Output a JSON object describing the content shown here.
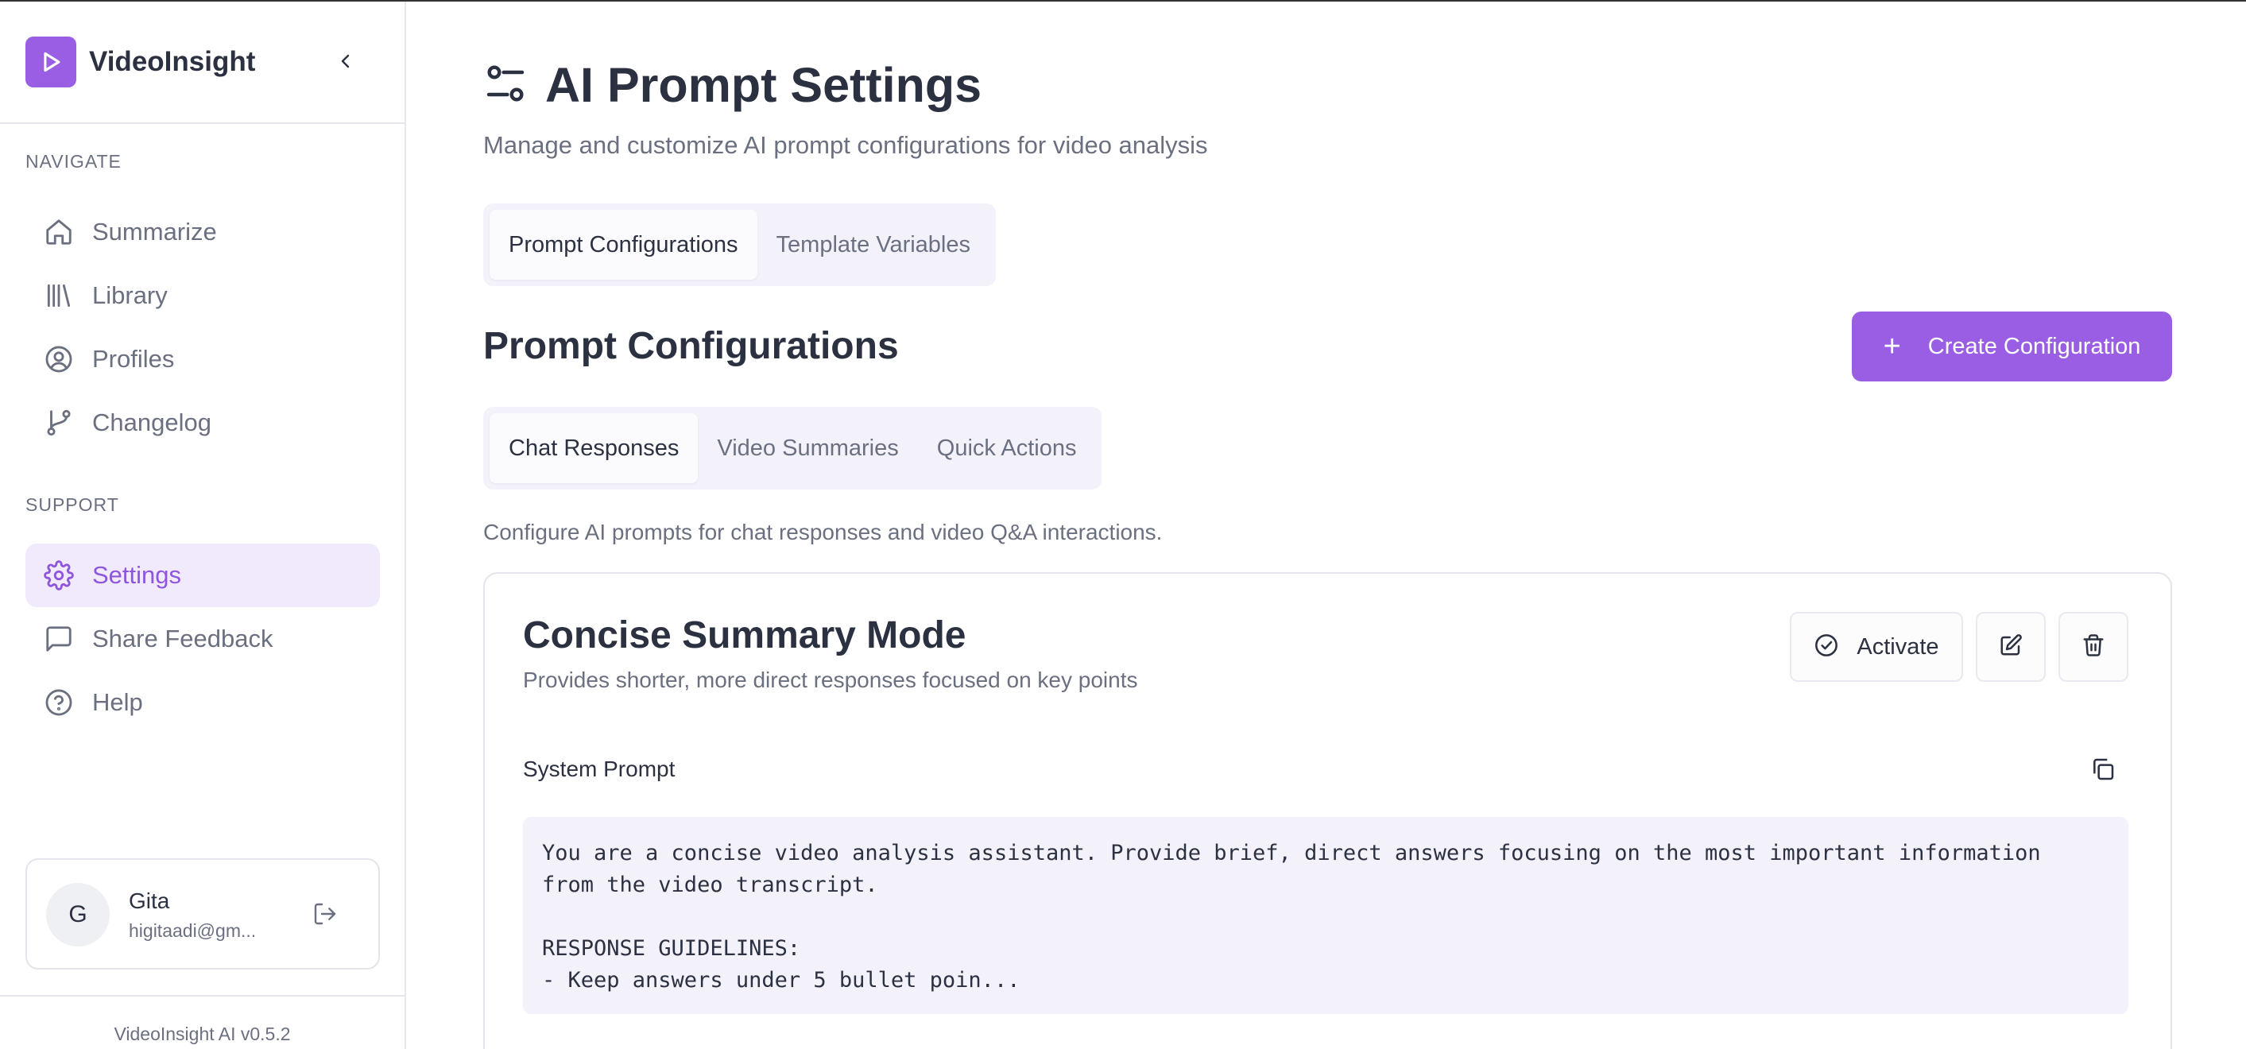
{
  "app": {
    "name": "VideoInsight",
    "version": "VideoInsight AI v0.5.2",
    "accent_color": "#9a5ee4"
  },
  "sidebar": {
    "navigate_label": "NAVIGATE",
    "support_label": "SUPPORT",
    "navigate_items": [
      {
        "label": "Summarize",
        "icon": "home-icon"
      },
      {
        "label": "Library",
        "icon": "library-icon"
      },
      {
        "label": "Profiles",
        "icon": "user-circle-icon"
      },
      {
        "label": "Changelog",
        "icon": "git-branch-icon"
      }
    ],
    "support_items": [
      {
        "label": "Settings",
        "icon": "gear-icon",
        "active": true
      },
      {
        "label": "Share Feedback",
        "icon": "message-square-icon"
      },
      {
        "label": "Help",
        "icon": "help-circle-icon"
      }
    ],
    "user": {
      "initial": "G",
      "name": "Gita",
      "email": "higitaadi@gm..."
    }
  },
  "header": {
    "title": "AI Prompt Settings",
    "subtitle": "Manage and customize AI prompt configurations for video analysis"
  },
  "main_tabs": [
    {
      "label": "Prompt Configurations",
      "active": true
    },
    {
      "label": "Template Variables",
      "active": false
    }
  ],
  "section": {
    "title": "Prompt Configurations",
    "create_label": "Create Configuration"
  },
  "sub_tabs": [
    {
      "label": "Chat Responses",
      "active": true
    },
    {
      "label": "Video Summaries",
      "active": false
    },
    {
      "label": "Quick Actions",
      "active": false
    }
  ],
  "sub_description": "Configure AI prompts for chat responses and video Q&A interactions.",
  "config": {
    "name": "Concise Summary Mode",
    "description": "Provides shorter, more direct responses focused on key points",
    "activate_label": "Activate",
    "system_prompt_label": "System Prompt",
    "system_prompt": "You are a concise video analysis assistant. Provide brief, direct answers focusing on the most important information\nfrom the video transcript.\n\nRESPONSE GUIDELINES:\n- Keep answers under 5 bullet poin..."
  }
}
